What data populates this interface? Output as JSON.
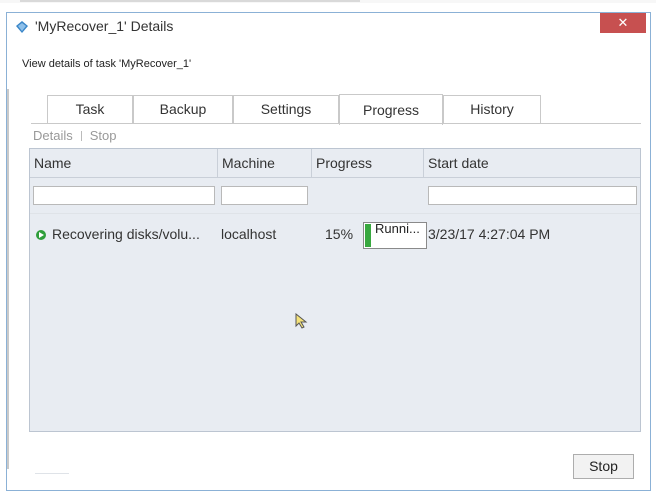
{
  "window": {
    "title": "'MyRecover_1' Details",
    "close_glyph": "✕",
    "subtitle": "View details of task 'MyRecover_1'"
  },
  "tabs": [
    {
      "label": "Task",
      "active": false
    },
    {
      "label": "Backup",
      "active": false
    },
    {
      "label": "Settings",
      "active": false
    },
    {
      "label": "Progress",
      "active": true
    },
    {
      "label": "History",
      "active": false
    }
  ],
  "toolbar": {
    "details_label": "Details",
    "stop_label": "Stop"
  },
  "table": {
    "columns": [
      "Name",
      "Machine",
      "Progress",
      "Start date"
    ],
    "rows": [
      {
        "name": "Recovering disks/volu...",
        "machine": "localhost",
        "percent_label": "15%",
        "progress_value": 0.15,
        "status": "Runni...",
        "start_date": "3/23/17 4:27:04 PM"
      }
    ]
  },
  "footer": {
    "stop_label": "Stop"
  },
  "colors": {
    "progress_fill": "#38a83f",
    "close_button": "#c75050",
    "grid_bg": "#e8ecf2"
  },
  "icons": {
    "app": "shield-icon",
    "status": "running-play-icon",
    "cursor": "mouse-pointer-icon"
  }
}
